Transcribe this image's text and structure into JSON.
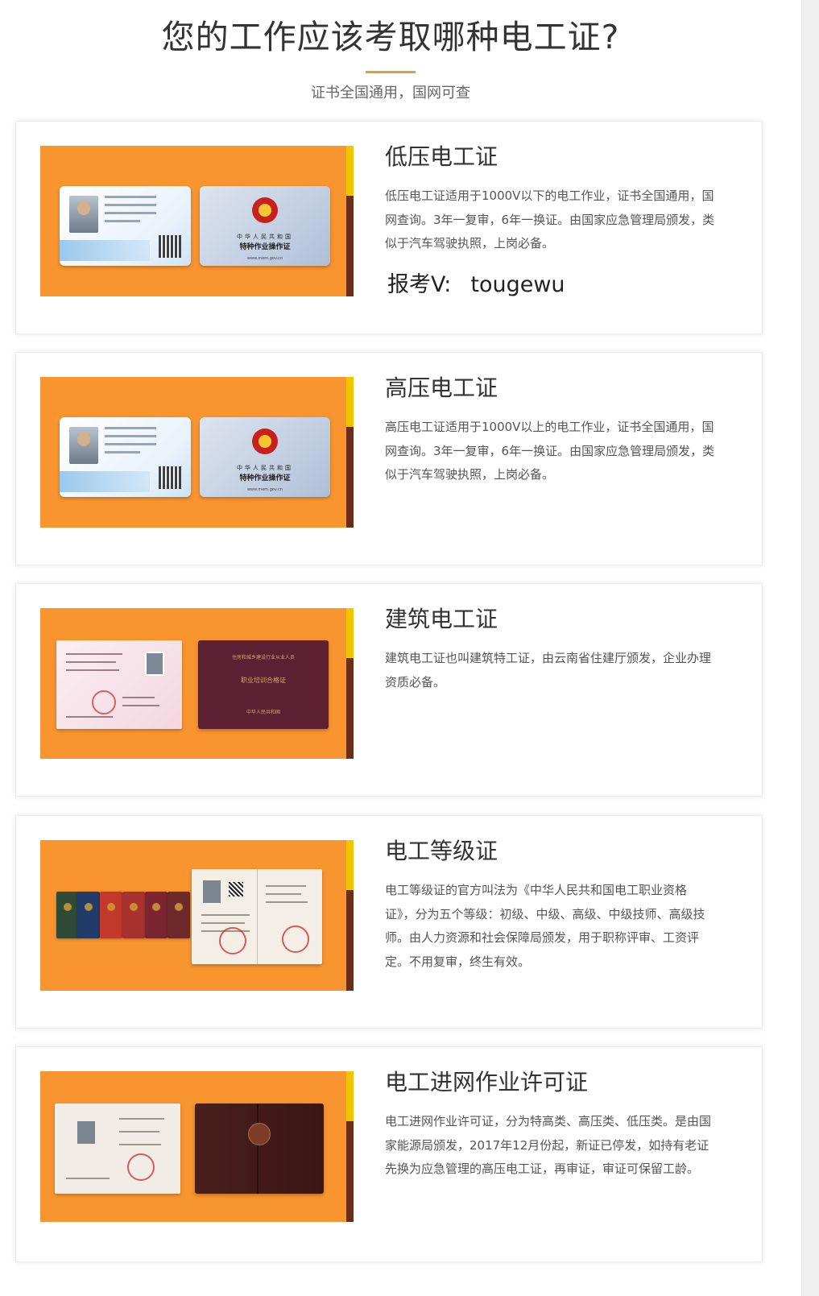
{
  "header": {
    "title": "您的工作应该考取哪种电工证?",
    "subtitle": "证书全国通用，国网可查"
  },
  "colors": {
    "accent_rule": "#c5a36b",
    "image_background": "#f9952f",
    "stripe_yellow": "#f5c400",
    "stripe_dark": "#6b2d1a"
  },
  "cards": [
    {
      "title": "低压电工证",
      "description": "低压电工证适用于1000V以下的电工作业，证书全国通用，国网查询。3年一复审，6年一换证。由国家应急管理局颁发，类似于汽车驾驶执照，上岗必备。",
      "contact_label": "报考V:",
      "contact_value": "tougewu",
      "image": "low-voltage-certificate-cards"
    },
    {
      "title": "高压电工证",
      "description": "高压电工证适用于1000V以上的电工作业，证书全国通用，国网查询。3年一复审，6年一换证。由国家应急管理局颁发，类似于汽车驾驶执照，上岗必备。",
      "image": "high-voltage-certificate-cards"
    },
    {
      "title": "建筑电工证",
      "description": "建筑电工证也叫建筑特工证，由云南省住建厅颁发，企业办理资质必备。",
      "image": "construction-electrician-certificate"
    },
    {
      "title": "电工等级证",
      "description": "电工等级证的官方叫法为《中华人民共和国电工职业资格证》，分为五个等级：初级、中级、高级、中级技师、高级技师。由人力资源和社会保障局颁发，用于职称评审、工资评定。不用复审，终生有效。",
      "image": "electrician-grade-certificate-booklets"
    },
    {
      "title": "电工进网作业许可证",
      "description": "电工进网作业许可证，分为特高类、高压类、低压类。是由国家能源局颁发，2017年12月份起，新证已停发，如持有老证先换为应急管理的高压电工证，再审证，审证可保留工龄。",
      "image": "grid-access-work-permit-booklet"
    }
  ]
}
